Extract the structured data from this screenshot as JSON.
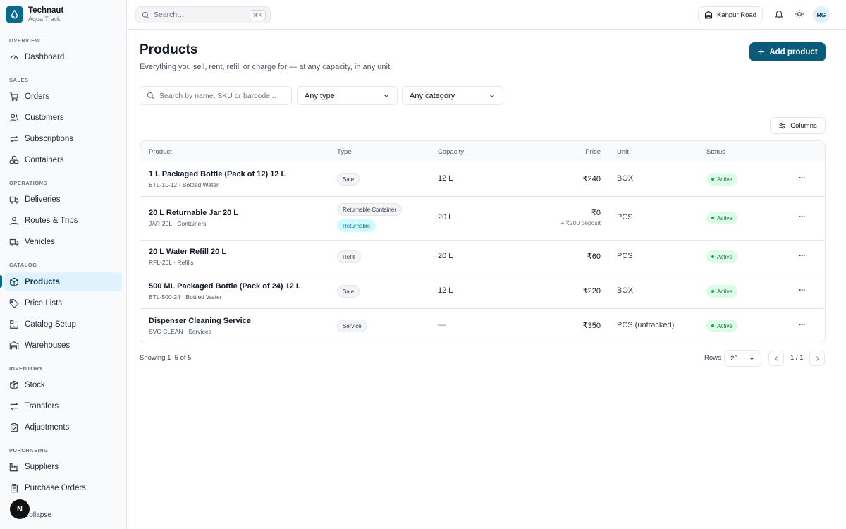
{
  "brand": {
    "name": "Technaut",
    "subtitle": "Aqua Track",
    "accent": "#0a6a8e"
  },
  "sidebar": {
    "sections": [
      {
        "label": "OVERVIEW",
        "items": [
          {
            "label": "Dashboard",
            "icon": "gauge-icon"
          }
        ]
      },
      {
        "label": "SALES",
        "items": [
          {
            "label": "Orders",
            "icon": "cart-icon"
          },
          {
            "label": "Customers",
            "icon": "users-icon"
          },
          {
            "label": "Subscriptions",
            "icon": "repeat-icon"
          },
          {
            "label": "Containers",
            "icon": "boxes-icon"
          }
        ]
      },
      {
        "label": "OPERATIONS",
        "items": [
          {
            "label": "Deliveries",
            "icon": "truck-icon"
          },
          {
            "label": "Routes & Trips",
            "icon": "route-icon"
          },
          {
            "label": "Vehicles",
            "icon": "truck-icon"
          }
        ]
      },
      {
        "label": "CATALOG",
        "items": [
          {
            "label": "Products",
            "icon": "package-icon",
            "active": true
          },
          {
            "label": "Price Lists",
            "icon": "tag-icon"
          },
          {
            "label": "Catalog Setup",
            "icon": "settings-grid-icon"
          },
          {
            "label": "Warehouses",
            "icon": "warehouse-icon"
          }
        ]
      },
      {
        "label": "INVENTORY",
        "items": [
          {
            "label": "Stock",
            "icon": "package-icon"
          },
          {
            "label": "Transfers",
            "icon": "arrows-icon"
          },
          {
            "label": "Adjustments",
            "icon": "clipboard-check-icon"
          }
        ]
      },
      {
        "label": "PURCHASING",
        "items": [
          {
            "label": "Suppliers",
            "icon": "factory-icon"
          },
          {
            "label": "Purchase Orders",
            "icon": "clipboard-icon"
          }
        ]
      }
    ],
    "collapse_label": "Collapse",
    "floating_badge": "N"
  },
  "topbar": {
    "search_placeholder": "Search…",
    "search_shortcut": "⌘K",
    "branch": "Kanpur Road",
    "avatar_initials": "RG"
  },
  "page": {
    "title": "Products",
    "subtitle": "Everything you sell, rent, refill or charge for — at any capacity, in any unit.",
    "add_button": "Add product"
  },
  "filters": {
    "search_placeholder": "Search by name, SKU or barcode...",
    "type_select": "Any type",
    "category_select": "Any category",
    "columns_button": "Columns"
  },
  "table": {
    "columns": [
      "Product",
      "Type",
      "Capacity",
      "Price",
      "Unit",
      "Status"
    ],
    "rows": [
      {
        "name": "1 L Packaged Bottle (Pack of 12) 12 L",
        "sku": "BTL-1L-12 · Bottled Water",
        "types": [
          "Sale"
        ],
        "capacity": "12 L",
        "price": "₹240",
        "deposit": "",
        "unit": "BOX",
        "status": "Active"
      },
      {
        "name": "20 L Returnable Jar 20 L",
        "sku": "JAR-20L · Containers",
        "types": [
          "Returnable Container",
          "Returnable"
        ],
        "capacity": "20 L",
        "price": "₹0",
        "deposit": "+ ₹200 deposit",
        "unit": "PCS",
        "status": "Active"
      },
      {
        "name": "20 L Water Refill 20 L",
        "sku": "RFL-20L · Refills",
        "types": [
          "Refill"
        ],
        "capacity": "20 L",
        "price": "₹60",
        "deposit": "",
        "unit": "PCS",
        "status": "Active"
      },
      {
        "name": "500 ML Packaged Bottle (Pack of 24) 12 L",
        "sku": "BTL-500-24 · Bottled Water",
        "types": [
          "Sale"
        ],
        "capacity": "12 L",
        "price": "₹220",
        "deposit": "",
        "unit": "BOX",
        "status": "Active"
      },
      {
        "name": "Dispenser Cleaning Service",
        "sku": "SVC-CLEAN · Services",
        "types": [
          "Service"
        ],
        "capacity": "—",
        "price": "₹350",
        "deposit": "",
        "unit": "PCS (untracked)",
        "status": "Active"
      }
    ]
  },
  "footer": {
    "showing": "Showing 1–5 of 5",
    "rows_label": "Rows",
    "rows_value": "25",
    "page_indicator": "1 / 1"
  }
}
